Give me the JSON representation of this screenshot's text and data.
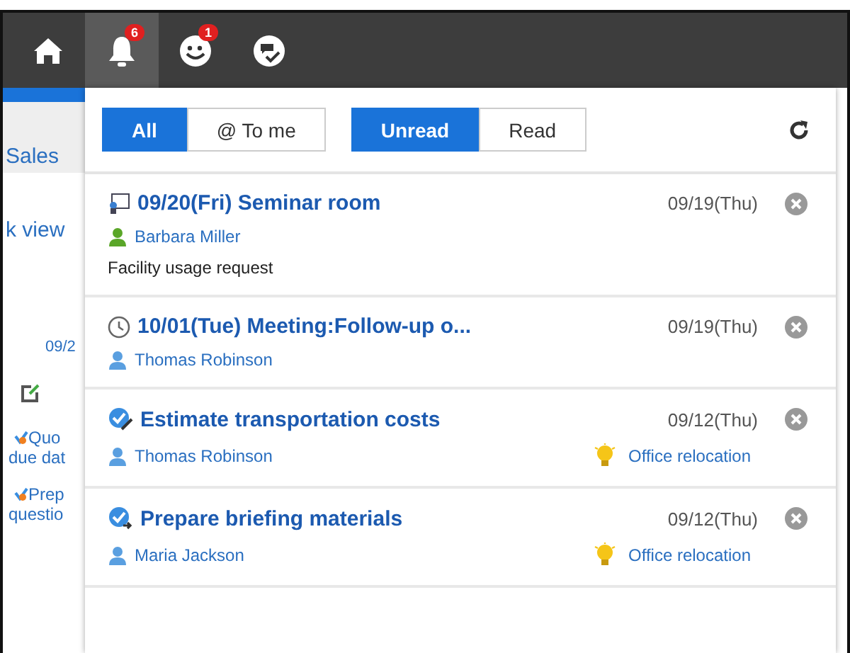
{
  "top_bar": {
    "items": [
      {
        "kind": "home",
        "selected": false
      },
      {
        "kind": "bell",
        "selected": true,
        "badge": "6"
      },
      {
        "kind": "smiley",
        "selected": false,
        "badge": "1"
      },
      {
        "kind": "globe",
        "selected": false
      }
    ]
  },
  "background_page": {
    "texts": [
      {
        "kind": "heading",
        "text": "Sales"
      },
      {
        "kind": "link",
        "text": "k view"
      },
      {
        "kind": "date",
        "text": "09/2"
      },
      {
        "kind": "edit"
      },
      {
        "kind": "todo",
        "text": "Quo"
      },
      {
        "kind": "plain-link",
        "text": "due dat"
      },
      {
        "kind": "todo",
        "text": "Prep"
      },
      {
        "kind": "plain-link",
        "text": "questio"
      }
    ]
  },
  "popup": {
    "filters": [
      [
        {
          "label": "All",
          "selected": true
        },
        {
          "label": "@ To me",
          "selected": false
        }
      ],
      [
        {
          "label": "Unread",
          "selected": true
        },
        {
          "label": "Read",
          "selected": false
        }
      ]
    ],
    "notifications": [
      {
        "kind": "facility",
        "title": "09/20(Fri) Seminar room",
        "date": "09/19(Thu)",
        "user": {
          "name": "Barbara Miller",
          "color": "#5aa628"
        },
        "detail": "Facility usage request"
      },
      {
        "kind": "schedule",
        "title": "10/01(Tue) Meeting:Follow-up o...",
        "date": "09/19(Thu)",
        "user": {
          "name": "Thomas Robinson",
          "color": "#5a9fe0"
        }
      },
      {
        "kind": "todo",
        "title": "Estimate transportation costs",
        "date": "09/12(Thu)",
        "user": {
          "name": "Thomas Robinson",
          "color": "#5a9fe0"
        },
        "space": "Office relocation"
      },
      {
        "kind": "todo-share",
        "title": "Prepare briefing materials",
        "date": "09/12(Thu)",
        "user": {
          "name": "Maria Jackson",
          "color": "#5a9fe0"
        },
        "space": "Office relocation"
      }
    ]
  }
}
